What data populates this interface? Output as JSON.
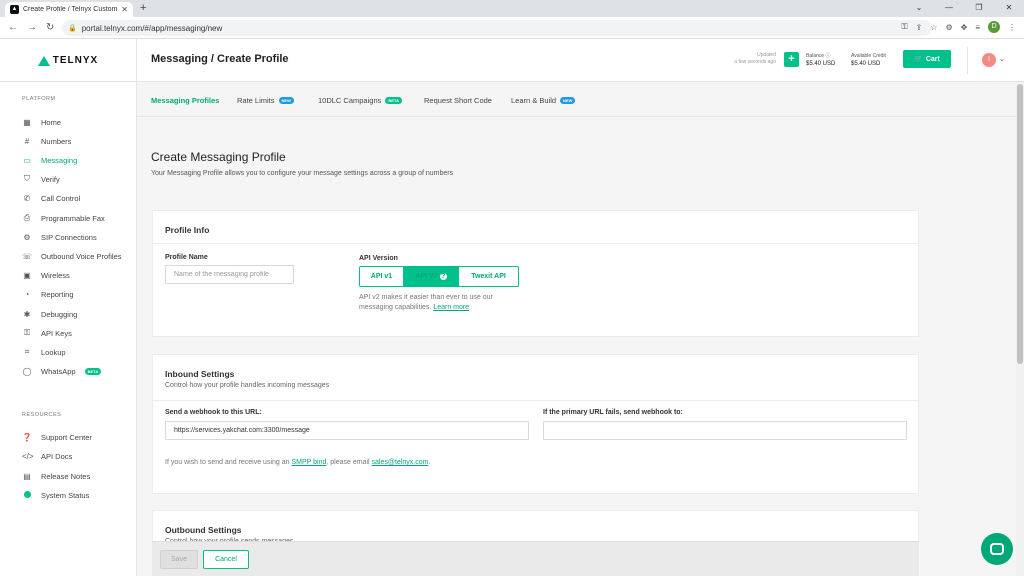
{
  "browser": {
    "tab_title": "Create Profile / Telnyx Customer",
    "url": "portal.telnyx.com/#/app/messaging/new",
    "profile_initial": "D"
  },
  "header": {
    "logo_text": "TELNYX",
    "breadcrumb": "Messaging / Create Profile",
    "updated_label": "Updated",
    "updated_value": "a few seconds ago",
    "balance_label": "Balance",
    "balance_value": "$5.40 USD",
    "credit_label": "Available Credit",
    "credit_value": "$5.40 USD",
    "cart_label": "Cart",
    "avatar_initial": "I"
  },
  "sidebar": {
    "platform_title": "PLATFORM",
    "platform_items": [
      {
        "label": "Home",
        "icon": "home-icon"
      },
      {
        "label": "Numbers",
        "icon": "numbers-icon"
      },
      {
        "label": "Messaging",
        "icon": "messaging-icon"
      },
      {
        "label": "Verify",
        "icon": "verify-icon"
      },
      {
        "label": "Call Control",
        "icon": "call-control-icon"
      },
      {
        "label": "Programmable Fax",
        "icon": "fax-icon"
      },
      {
        "label": "SIP Connections",
        "icon": "sip-icon"
      },
      {
        "label": "Outbound Voice Profiles",
        "icon": "outbound-voice-icon"
      },
      {
        "label": "Wireless",
        "icon": "wireless-icon"
      },
      {
        "label": "Reporting",
        "icon": "reporting-icon"
      },
      {
        "label": "Debugging",
        "icon": "debugging-icon"
      },
      {
        "label": "API Keys",
        "icon": "api-keys-icon"
      },
      {
        "label": "Lookup",
        "icon": "lookup-icon"
      },
      {
        "label": "WhatsApp",
        "icon": "whatsapp-icon",
        "badge": "BETA"
      }
    ],
    "resources_title": "RESOURCES",
    "resource_items": [
      {
        "label": "Support Center",
        "icon": "support-icon"
      },
      {
        "label": "API Docs",
        "icon": "code-icon"
      },
      {
        "label": "Release Notes",
        "icon": "release-notes-icon"
      },
      {
        "label": "System Status",
        "icon": "status-dot-icon"
      }
    ]
  },
  "subtabs": [
    {
      "label": "Messaging Profiles"
    },
    {
      "label": "Rate Limits",
      "badge": "NEW"
    },
    {
      "label": "10DLC Campaigns",
      "badge": "BETA"
    },
    {
      "label": "Request Short Code"
    },
    {
      "label": "Learn & Build",
      "badge": "NEW"
    }
  ],
  "main": {
    "title": "Create Messaging Profile",
    "description": "Your Messaging Profile allows you to configure your message settings across a group of numbers",
    "profile_info": {
      "heading": "Profile Info",
      "name_label": "Profile Name",
      "name_placeholder": "Name of the messaging profile",
      "api_label": "API Version",
      "api_options": [
        "API v1",
        "API V2",
        "Twexit API"
      ],
      "help_text": "API v2 makes it easier than ever to use our messaging capabilities.",
      "learn_more": "Learn more"
    },
    "inbound": {
      "heading": "Inbound Settings",
      "subheading": "Control how your profile handles incoming messages",
      "webhook_label": "Send a webhook to this URL:",
      "webhook_value": "https://services.yakchat.com:3300/message",
      "failover_label": "If the primary URL fails, send webhook to:",
      "failover_value": "",
      "smpp_prefix": "If you wish to send and receive using an",
      "smpp_link": "SMPP bind",
      "smpp_middle": ", please email",
      "smpp_email": "sales@telnyx.com",
      "smpp_suffix": "."
    },
    "outbound": {
      "heading": "Outbound Settings",
      "subheading": "Control how your profile sends messages"
    }
  },
  "footer": {
    "save_label": "Save",
    "cancel_label": "Cancel"
  }
}
